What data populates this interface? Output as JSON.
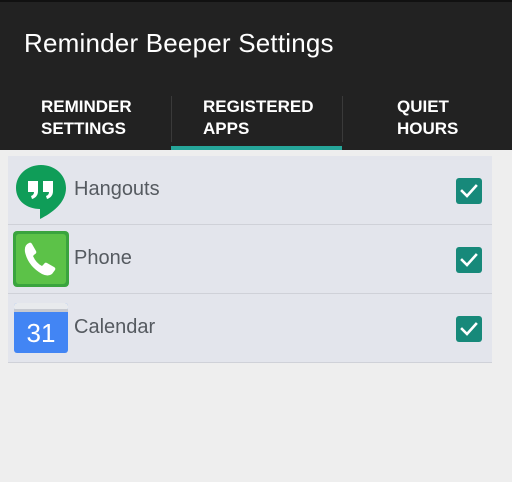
{
  "app": {
    "title": "Reminder Beeper Settings"
  },
  "tabs": [
    {
      "line1": "Reminder",
      "line2": "Settings",
      "selected": false
    },
    {
      "line1": "Registered",
      "line2": "Apps",
      "selected": true
    },
    {
      "line1": "Quiet",
      "line2": "Hours",
      "selected": false
    }
  ],
  "apps": [
    {
      "name": "Hangouts",
      "icon": "hangouts-icon",
      "checked": true
    },
    {
      "name": "Phone",
      "icon": "phone-icon",
      "checked": true
    },
    {
      "name": "Calendar",
      "icon": "calendar-icon",
      "checked": true,
      "icon_text": "31"
    }
  ],
  "colors": {
    "accent": "#26a69a",
    "appbar": "#222222",
    "checkbox": "#17897a"
  }
}
